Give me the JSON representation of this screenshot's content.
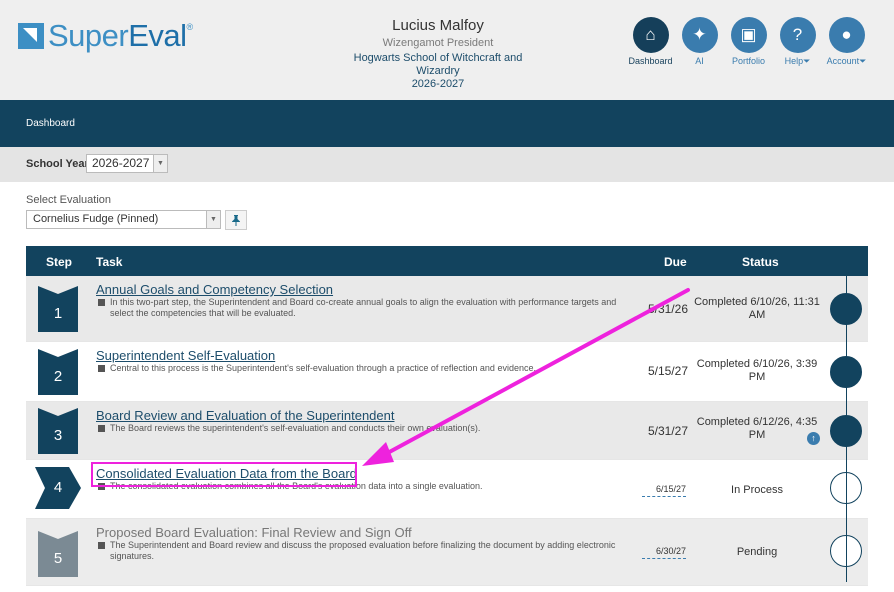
{
  "brand": {
    "name_a": "Super",
    "name_b": "Eval",
    "tm": "®"
  },
  "user": {
    "name": "Lucius Malfoy",
    "role": "Wizengamot President",
    "school": "Hogwarts School of Witchcraft and Wizardry",
    "year": "2026-2027"
  },
  "nav": [
    {
      "label": "Dashboard",
      "icon": "home-icon",
      "glyph": "⌂",
      "active": true
    },
    {
      "label": "AI",
      "icon": "sparkle-icon",
      "glyph": "✦",
      "active": false
    },
    {
      "label": "Portfolio",
      "icon": "briefcase-icon",
      "glyph": "▣",
      "active": false
    },
    {
      "label": "Help",
      "icon": "help-icon",
      "glyph": "?",
      "active": false,
      "caret": "⏷"
    },
    {
      "label": "Account",
      "icon": "account-icon",
      "glyph": "●",
      "active": false,
      "caret": "⏷"
    }
  ],
  "breadcrumb": "Dashboard",
  "school_year": {
    "label": "School Year:",
    "value": "2026-2027"
  },
  "evaluation": {
    "label": "Select Evaluation",
    "value": "Cornelius Fudge (Pinned)"
  },
  "table": {
    "headers": {
      "step": "Step",
      "task": "Task",
      "due": "Due",
      "status": "Status"
    },
    "rows": [
      {
        "step": "1",
        "title": "Annual Goals and Competency Selection",
        "desc": "In this two-part step, the Superintendent and Board co-create annual goals to align the evaluation with performance targets and select the competencies that will be evaluated.",
        "due": "5/31/26",
        "status": "Completed 6/10/26, 11:31 AM",
        "state": "done"
      },
      {
        "step": "2",
        "title": "Superintendent Self-Evaluation",
        "desc": "Central to this process is the Superintendent's self-evaluation through a practice of reflection and evidence.",
        "due": "5/15/27",
        "status": "Completed 6/10/26, 3:39 PM",
        "state": "done"
      },
      {
        "step": "3",
        "title": "Board Review and Evaluation of the Superintendent",
        "desc": "The Board reviews the superintendent's self-evaluation and conducts their own evaluation(s).",
        "due": "5/31/27",
        "status": "Completed 6/12/26, 4:35 PM",
        "state": "done"
      },
      {
        "step": "4",
        "title": "Consolidated Evaluation Data from the Board",
        "desc": "The consolidated evaluation combines all the Board's evaluation data into a single evaluation.",
        "due": "6/15/27",
        "status": "In Process",
        "state": "current"
      },
      {
        "step": "5",
        "title": "Proposed Board Evaluation: Final Review and Sign Off",
        "desc": "The Superintendent and Board review and discuss the proposed evaluation before finalizing the document by adding electronic signatures.",
        "due": "6/30/27",
        "status": "Pending",
        "state": "future"
      }
    ]
  },
  "colors": {
    "navy": "#12435e",
    "blue": "#3a7cae",
    "annotation": "#ee22dd",
    "future_badge": "#7b8a94"
  }
}
